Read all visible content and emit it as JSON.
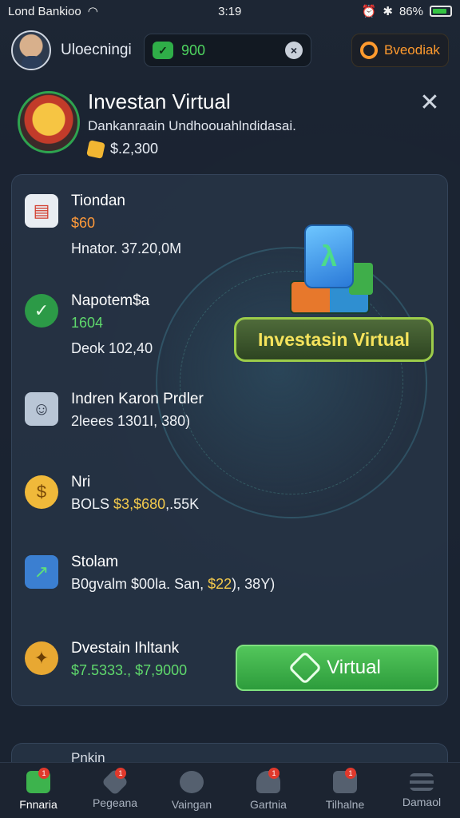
{
  "status_bar": {
    "carrier": "Lond Bankioo",
    "time": "3:19",
    "battery": "86%"
  },
  "header": {
    "username": "Uloecningi",
    "balance": "900",
    "feedback_label": "Bveodiak"
  },
  "modal": {
    "title": "Investan Virtual",
    "subtitle": "Dankanraain Undhoouahlndidasai.",
    "coins": "$.2,300"
  },
  "items": [
    {
      "title": "Tiondan",
      "line2": "$60",
      "line3": "Hnator. 37.20,0M"
    },
    {
      "title": "Napotem$a",
      "line2": "1604",
      "line3": "Deok  102,40"
    },
    {
      "title": "Indren Karon Prdler",
      "line2": "2leees 1301I, 380)"
    },
    {
      "title": "Nri",
      "line2_prefix": "BOLS",
      "line2_value": "$3,$680",
      "line2_suffix": ",.55K"
    },
    {
      "title": "Stolam",
      "line2_prefix": "B0gvalm $00la. San,",
      "line2_value": "$22",
      "line2_suffix": "), 38Y)"
    },
    {
      "title": "Dvestain Ihltank",
      "line2": "$7.5333., $7,9000"
    }
  ],
  "promo": {
    "banner": "Investasin Virtual",
    "button": "Virtual"
  },
  "peek": {
    "label": "Pnkin"
  },
  "nav": [
    {
      "label": "Fnnaria",
      "badge": "1"
    },
    {
      "label": "Pegeana",
      "badge": "1"
    },
    {
      "label": "Vaingan",
      "badge": ""
    },
    {
      "label": "Gartnia",
      "badge": "1"
    },
    {
      "label": "Tilhalne",
      "badge": "1"
    },
    {
      "label": "Damaol",
      "badge": ""
    }
  ]
}
